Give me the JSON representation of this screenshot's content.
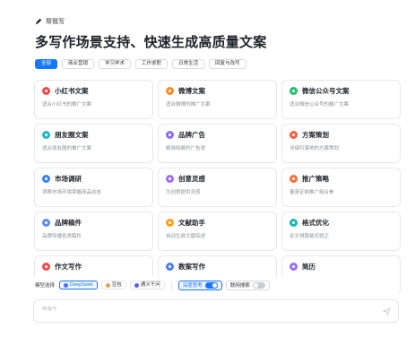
{
  "brand": {
    "label": "帮我写",
    "icon": "pen-sparkle-icon"
  },
  "headline": "多写作场景支持、快速生成高质量文案",
  "tabs": [
    {
      "label": "全部",
      "active": true
    },
    {
      "label": "商业营销",
      "active": false
    },
    {
      "label": "学习学术",
      "active": false
    },
    {
      "label": "工作求职",
      "active": false
    },
    {
      "label": "日常生活",
      "active": false
    },
    {
      "label": "回复与改写",
      "active": false
    }
  ],
  "cards": [
    {
      "title": "小红书文案",
      "desc": "适合小红书的推广文案",
      "icon": "xiaohongshu-icon",
      "color": "#f5484a"
    },
    {
      "title": "微博文案",
      "desc": "适合微博的推广文案",
      "icon": "weibo-icon",
      "color": "#ff8a1f"
    },
    {
      "title": "微信公众号文案",
      "desc": "适合微信公众号的推广文案",
      "icon": "wechat-icon",
      "color": "#21c06b"
    },
    {
      "title": "朋友圈文案",
      "desc": "适合朋友圈的推广文案",
      "icon": "moments-icon",
      "color": "#22b8c8"
    },
    {
      "title": "品牌广告",
      "desc": "精准吸睛的广告语",
      "icon": "megaphone-icon",
      "color": "#8b6cf2"
    },
    {
      "title": "方案策划",
      "desc": "详细可落地的方案策划",
      "icon": "plan-icon",
      "color": "#ff5a3c"
    },
    {
      "title": "市场调研",
      "desc": "洞察市场环境掌握商品动态",
      "icon": "survey-icon",
      "color": "#3b82f6"
    },
    {
      "title": "创意灵感",
      "desc": "为创意提供灵感",
      "icon": "lightbulb-icon",
      "color": "#a56cf0"
    },
    {
      "title": "推广策略",
      "desc": "量身定制推广组合拳",
      "icon": "strategy-icon",
      "color": "#ff6b35"
    },
    {
      "title": "品牌稿件",
      "desc": "品牌传播各类稿件",
      "icon": "document-icon",
      "color": "#5b8def"
    },
    {
      "title": "文献助手",
      "desc": "自动生成文献综述",
      "icon": "book-icon",
      "color": "#ff9f1a"
    },
    {
      "title": "格式优化",
      "desc": "论文排版格式修正",
      "icon": "format-icon",
      "color": "#16b8b0"
    },
    {
      "title": "作文写作",
      "desc": "",
      "icon": "essay-icon",
      "color": "#f5484a"
    },
    {
      "title": "教案写作",
      "desc": "",
      "icon": "lesson-plan-icon",
      "color": "#4f7cf7"
    },
    {
      "title": "简历",
      "desc": "",
      "icon": "resume-icon",
      "color": "#9b6cf2"
    }
  ],
  "composer": {
    "model_label": "模型选择",
    "models": [
      {
        "label": "DeepSeek",
        "active": true,
        "icon": "deepseek-icon",
        "color": "#4d6bfe"
      },
      {
        "label": "豆包",
        "active": false,
        "icon": "doubao-icon",
        "color": "#e0a063"
      },
      {
        "label": "通义千问",
        "active": false,
        "icon": "tongyi-icon",
        "color": "#615ced"
      }
    ],
    "deep_think_label": "深度思考",
    "deep_think_on": true,
    "web_search_label": "联网搜索",
    "web_search_on": false,
    "placeholder": "帮我写",
    "send_icon": "send-icon"
  }
}
